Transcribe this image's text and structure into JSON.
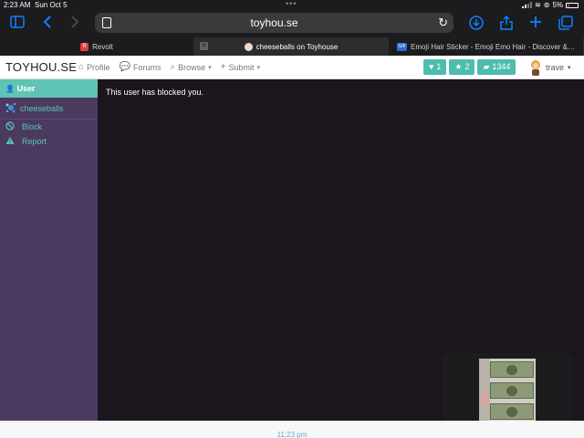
{
  "status_bar": {
    "time": "2:23 AM",
    "date": "Sun Oct 5",
    "battery": "5%"
  },
  "browser": {
    "url": "toyhou.se",
    "tabs": [
      {
        "label": "Revolt",
        "favicon_color": "#e0403a",
        "active": false
      },
      {
        "label": "cheeseballs on Toyhouse",
        "active": true
      },
      {
        "label": "Emoji Hair Sticker - Emoji Emo Hair - Discover &…",
        "favicon_color": "#2f6bd6",
        "active": false
      }
    ],
    "favicon_gif": "GIF",
    "favicon_r": "R"
  },
  "site": {
    "logo": "TOYHOU.SE",
    "nav": [
      {
        "label": "Profile",
        "icon": "home-icon"
      },
      {
        "label": "Forums",
        "icon": "chat-icon"
      },
      {
        "label": "Browse",
        "icon": "search-icon"
      },
      {
        "label": "Submit",
        "icon": "plus-icon"
      }
    ],
    "counters": [
      {
        "value": "1",
        "icon": "heart-icon"
      },
      {
        "value": "2",
        "icon": "star-icon"
      },
      {
        "value": "1344",
        "icon": "messages-icon"
      }
    ],
    "username": "trave",
    "accent": "#4dbdad"
  },
  "sidebar": {
    "header": "User",
    "user": "cheeseballs",
    "links": [
      {
        "label": "Block",
        "icon": "ban-icon"
      },
      {
        "label": "Report",
        "icon": "warning-icon"
      }
    ]
  },
  "content": {
    "message": "This user has blocked you."
  },
  "footer": {
    "time": "11:23 pm"
  }
}
